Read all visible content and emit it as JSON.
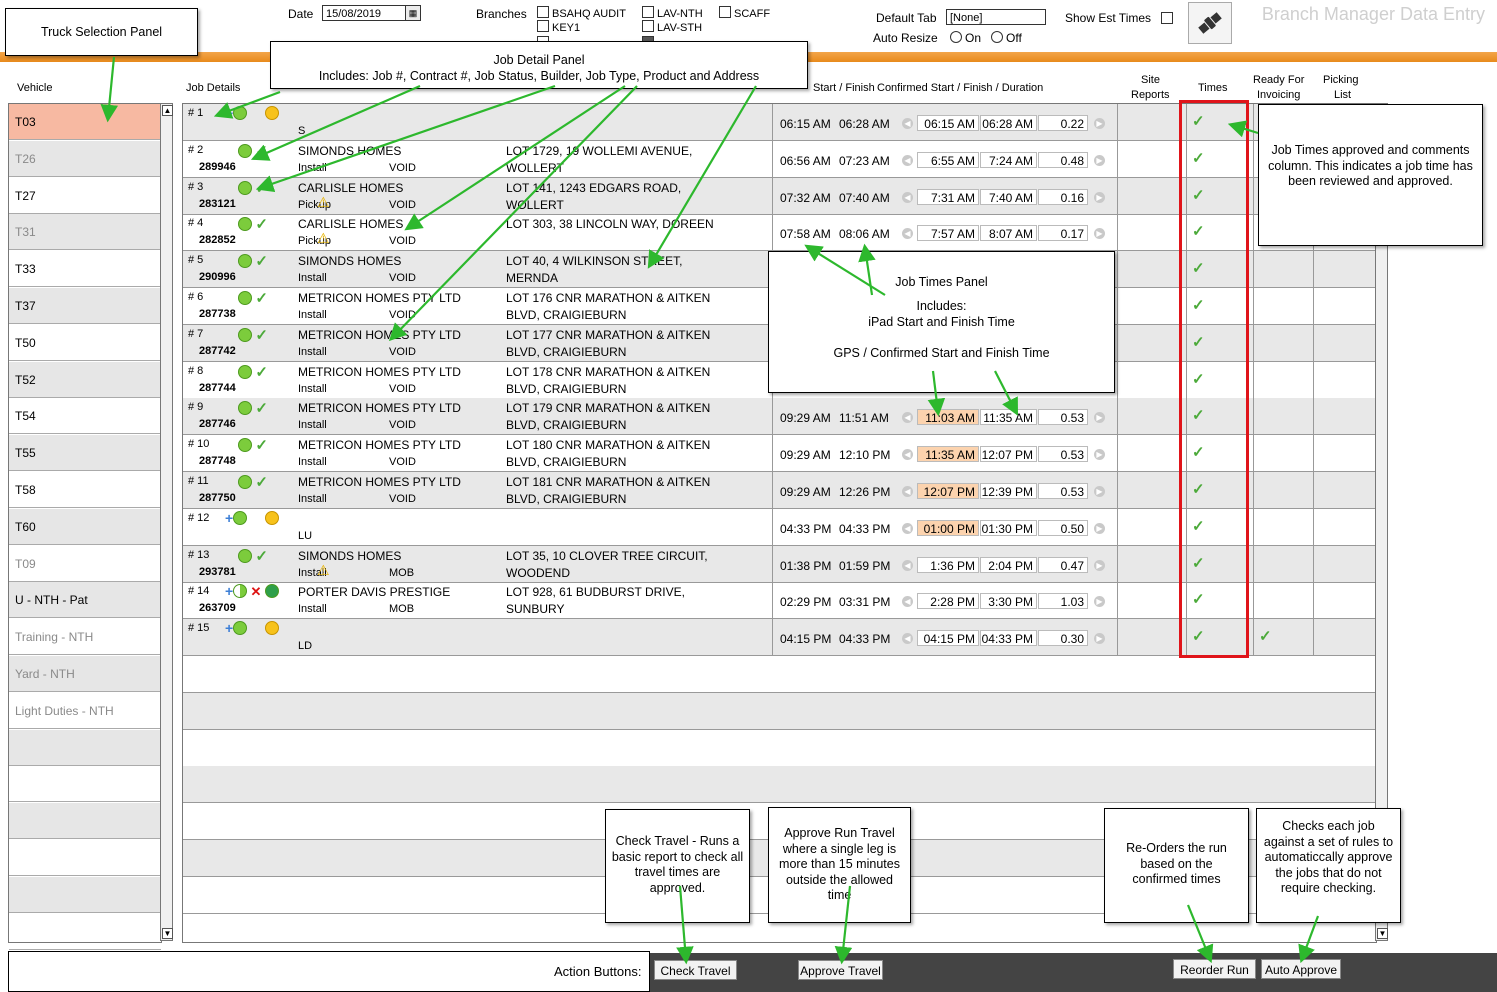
{
  "header": {
    "date_label": "Date",
    "date_value": "15/08/2019",
    "branches_label": "Branches",
    "branches": [
      {
        "label": "BSAHQ AUDIT",
        "checked": false
      },
      {
        "label": "KEY1",
        "checked": false
      },
      {
        "label": "LAV-NTH",
        "checked": false
      },
      {
        "label": "LAV-STH",
        "checked": false
      },
      {
        "label": "SCAFF",
        "checked": false
      }
    ],
    "default_tab_label": "Default Tab",
    "default_tab_value": "[None]",
    "auto_resize_label": "Auto Resize",
    "auto_resize_on": "On",
    "auto_resize_off": "Off",
    "show_est_times_label": "Show Est Times",
    "app_title": "Branch Manager Data Entry"
  },
  "columns": {
    "vehicle": "Vehicle",
    "job_details": "Job Details",
    "start_finish": "Start / Finish",
    "confirmed": "Confirmed Start / Finish / Duration",
    "site_reports_1": "Site",
    "site_reports_2": "Reports",
    "times": "Times",
    "ready_1": "Ready For",
    "ready_2": "Invoicing",
    "picking_1": "Picking",
    "picking_2": "List"
  },
  "vehicles": [
    {
      "name": "T03",
      "style": "sel"
    },
    {
      "name": "T26",
      "style": "dim alt"
    },
    {
      "name": "T27",
      "style": ""
    },
    {
      "name": "T31",
      "style": "dim alt"
    },
    {
      "name": "T33",
      "style": ""
    },
    {
      "name": "T37",
      "style": "alt"
    },
    {
      "name": "T50",
      "style": ""
    },
    {
      "name": "T52",
      "style": "alt"
    },
    {
      "name": "T54",
      "style": ""
    },
    {
      "name": "T55",
      "style": "alt"
    },
    {
      "name": "T58",
      "style": ""
    },
    {
      "name": "T60",
      "style": "alt"
    },
    {
      "name": "T09",
      "style": "dim"
    },
    {
      "name": "U - NTH - Pat",
      "style": "alt"
    },
    {
      "name": "Training - NTH",
      "style": "dim"
    },
    {
      "name": "Yard - NTH",
      "style": "dim alt"
    },
    {
      "name": "Light Duties - NTH",
      "style": "dim"
    },
    {
      "name": "",
      "style": "alt"
    },
    {
      "name": "",
      "style": ""
    },
    {
      "name": "",
      "style": "alt"
    },
    {
      "name": "",
      "style": ""
    },
    {
      "name": "",
      "style": "alt"
    },
    {
      "name": "",
      "style": ""
    }
  ],
  "jobs": [
    {
      "num": "# 1",
      "contract": "",
      "builder": "",
      "type": "S",
      "status": "",
      "addr1": "",
      "addr2": "",
      "icons": "plus-green-yellow",
      "start": "06:15 AM",
      "finish": "06:28 AM",
      "cstart": "06:15 AM",
      "cfinish": "06:28 AM",
      "dur": "0.22",
      "hl": false,
      "times_ok": true,
      "ready_ok": false
    },
    {
      "num": "# 2",
      "contract": "289946",
      "builder": "SIMONDS HOMES",
      "type": "Install",
      "status": "VOID",
      "addr1": "LOT 1729, 19 WOLLEMI AVENUE,",
      "addr2": "WOLLERT",
      "icons": "green-check",
      "start": "06:56 AM",
      "finish": "07:23 AM",
      "cstart": "6:55 AM",
      "cfinish": "7:24 AM",
      "dur": "0.48",
      "hl": false,
      "times_ok": true,
      "ready_ok": false
    },
    {
      "num": "# 3",
      "contract": "283121",
      "builder": "CARLISLE HOMES",
      "type": "Pickup",
      "status": "VOID",
      "addr1": "LOT 141, 1243 EDGARS ROAD,",
      "addr2": "WOLLERT",
      "icons": "green-check",
      "start": "07:32 AM",
      "finish": "07:40 AM",
      "cstart": "7:31 AM",
      "cfinish": "7:40 AM",
      "dur": "0.16",
      "hl": false,
      "times_ok": true,
      "ready_ok": false
    },
    {
      "num": "# 4",
      "contract": "282852",
      "builder": "CARLISLE HOMES",
      "type": "Pickup",
      "status": "VOID",
      "addr1": "LOT 303, 38 LINCOLN WAY, DOREEN",
      "addr2": "",
      "icons": "green-check",
      "start": "07:58 AM",
      "finish": "08:06 AM",
      "cstart": "7:57 AM",
      "cfinish": "8:07 AM",
      "dur": "0.17",
      "hl": false,
      "times_ok": true,
      "ready_ok": false
    },
    {
      "num": "# 5",
      "contract": "290996",
      "builder": "SIMONDS HOMES",
      "type": "Install",
      "status": "VOID",
      "addr1": "LOT 40, 4 WILKINSON STREET,",
      "addr2": "MERNDA",
      "icons": "green-check",
      "start": "",
      "finish": "",
      "cstart": "",
      "cfinish": "",
      "dur": "",
      "hl": false,
      "times_ok": true,
      "ready_ok": false
    },
    {
      "num": "# 6",
      "contract": "287738",
      "builder": "METRICON HOMES PTY LTD",
      "type": "Install",
      "status": "VOID",
      "addr1": "LOT 176 CNR MARATHON & AITKEN",
      "addr2": "BLVD, CRAIGIEBURN",
      "icons": "green-check",
      "start": "",
      "finish": "",
      "cstart": "",
      "cfinish": "",
      "dur": "",
      "hl": false,
      "times_ok": true,
      "ready_ok": false
    },
    {
      "num": "# 7",
      "contract": "287742",
      "builder": "METRICON HOMES PTY LTD",
      "type": "Install",
      "status": "VOID",
      "addr1": "LOT 177 CNR MARATHON & AITKEN",
      "addr2": "BLVD, CRAIGIEBURN",
      "icons": "green-check",
      "start": "",
      "finish": "",
      "cstart": "",
      "cfinish": "",
      "dur": "",
      "hl": false,
      "times_ok": true,
      "ready_ok": false
    },
    {
      "num": "# 8",
      "contract": "287744",
      "builder": "METRICON HOMES PTY LTD",
      "type": "Install",
      "status": "VOID",
      "addr1": "LOT 178 CNR MARATHON & AITKEN",
      "addr2": "BLVD, CRAIGIEBURN",
      "icons": "green-check",
      "start": "",
      "finish": "",
      "cstart": "",
      "cfinish": "",
      "dur": "",
      "hl": false,
      "times_ok": true,
      "ready_ok": false
    },
    {
      "num": "# 9",
      "contract": "287746",
      "builder": "METRICON HOMES PTY LTD",
      "type": "Install",
      "status": "VOID",
      "addr1": "LOT 179 CNR MARATHON & AITKEN",
      "addr2": "BLVD, CRAIGIEBURN",
      "icons": "green-check",
      "start": "09:29 AM",
      "finish": "11:51 AM",
      "cstart": "11:03 AM",
      "cfinish": "11:35 AM",
      "dur": "0.53",
      "hl": true,
      "times_ok": true,
      "ready_ok": false
    },
    {
      "num": "# 10",
      "contract": "287748",
      "builder": "METRICON HOMES PTY LTD",
      "type": "Install",
      "status": "VOID",
      "addr1": "LOT 180 CNR MARATHON & AITKEN",
      "addr2": "BLVD, CRAIGIEBURN",
      "icons": "green-check",
      "start": "09:29 AM",
      "finish": "12:10 PM",
      "cstart": "11:35 AM",
      "cfinish": "12:07 PM",
      "dur": "0.53",
      "hl": true,
      "times_ok": true,
      "ready_ok": false
    },
    {
      "num": "# 11",
      "contract": "287750",
      "builder": "METRICON HOMES PTY LTD",
      "type": "Install",
      "status": "VOID",
      "addr1": "LOT 181 CNR MARATHON & AITKEN",
      "addr2": "BLVD, CRAIGIEBURN",
      "icons": "green-check",
      "start": "09:29 AM",
      "finish": "12:26 PM",
      "cstart": "12:07 PM",
      "cfinish": "12:39 PM",
      "dur": "0.53",
      "hl": true,
      "times_ok": true,
      "ready_ok": false
    },
    {
      "num": "# 12",
      "contract": "",
      "builder": "",
      "type": "LU",
      "status": "",
      "addr1": "",
      "addr2": "",
      "icons": "plus-green-yellow",
      "start": "04:33 PM",
      "finish": "04:33 PM",
      "cstart": "01:00 PM",
      "cfinish": "01:30 PM",
      "dur": "0.50",
      "hl": true,
      "times_ok": true,
      "ready_ok": false
    },
    {
      "num": "# 13",
      "contract": "293781",
      "builder": "SIMONDS HOMES",
      "type": "Install",
      "status": "MOB",
      "addr1": "LOT 35, 10 CLOVER TREE CIRCUIT,",
      "addr2": "WOODEND",
      "icons": "green-check",
      "start": "01:38 PM",
      "finish": "01:59 PM",
      "cstart": "1:36 PM",
      "cfinish": "2:04 PM",
      "dur": "0.47",
      "hl": false,
      "times_ok": true,
      "ready_ok": false
    },
    {
      "num": "# 14",
      "contract": "263709",
      "builder": "PORTER DAVIS PRESTIGE",
      "type": "Install",
      "status": "MOB",
      "addr1": "LOT 928, 61 BUDBURST DRIVE,",
      "addr2": "SUNBURY",
      "icons": "plus-half-x-green",
      "start": "02:29 PM",
      "finish": "03:31 PM",
      "cstart": "2:28 PM",
      "cfinish": "3:30 PM",
      "dur": "1.03",
      "hl": false,
      "times_ok": true,
      "ready_ok": false
    },
    {
      "num": "# 15",
      "contract": "",
      "builder": "",
      "type": "LD",
      "status": "",
      "addr1": "",
      "addr2": "",
      "icons": "plus-green-yellow",
      "start": "04:15 PM",
      "finish": "04:33 PM",
      "cstart": "04:15 PM",
      "cfinish": "04:33 PM",
      "dur": "0.30",
      "hl": false,
      "times_ok": true,
      "ready_ok": true
    }
  ],
  "buttons": {
    "action_label": "Action Buttons:",
    "check_travel": "Check Travel",
    "approve_travel": "Approve Travel",
    "reorder_run": "Reorder Run",
    "auto_approve": "Auto Approve"
  },
  "annotations": {
    "truck_panel": "Truck Selection Panel",
    "job_detail_1": "Job Detail Panel",
    "job_detail_2": "Includes: Job #, Contract #, Job Status, Builder, Job Type, Product and Address",
    "times_panel_1": "Job Times Panel",
    "times_panel_2": "Includes:",
    "times_panel_3": "iPad Start and Finish Time",
    "times_panel_4": "GPS / Confirmed Start and Finish Time",
    "times_approved": "Job Times approved and comments column. This indicates a job time has been reviewed and approved.",
    "check_travel": "Check Travel - Runs a basic report to check all travel times are approved.",
    "approve_travel": "Approve Run Travel where a single leg is more than 15 minutes outside the allowed time",
    "reorder": "Re-Orders the run based on the confirmed times",
    "auto_approve": "Checks each job against a set of rules to automaticcally approve the jobs that do not require checking."
  },
  "colors": {
    "orange_bar": "#e88a1c",
    "selected_vehicle": "#f7b9a2",
    "highlight_time": "#fcd3ae",
    "approved_check": "#4caa3a",
    "red_box": "#e0141a"
  }
}
